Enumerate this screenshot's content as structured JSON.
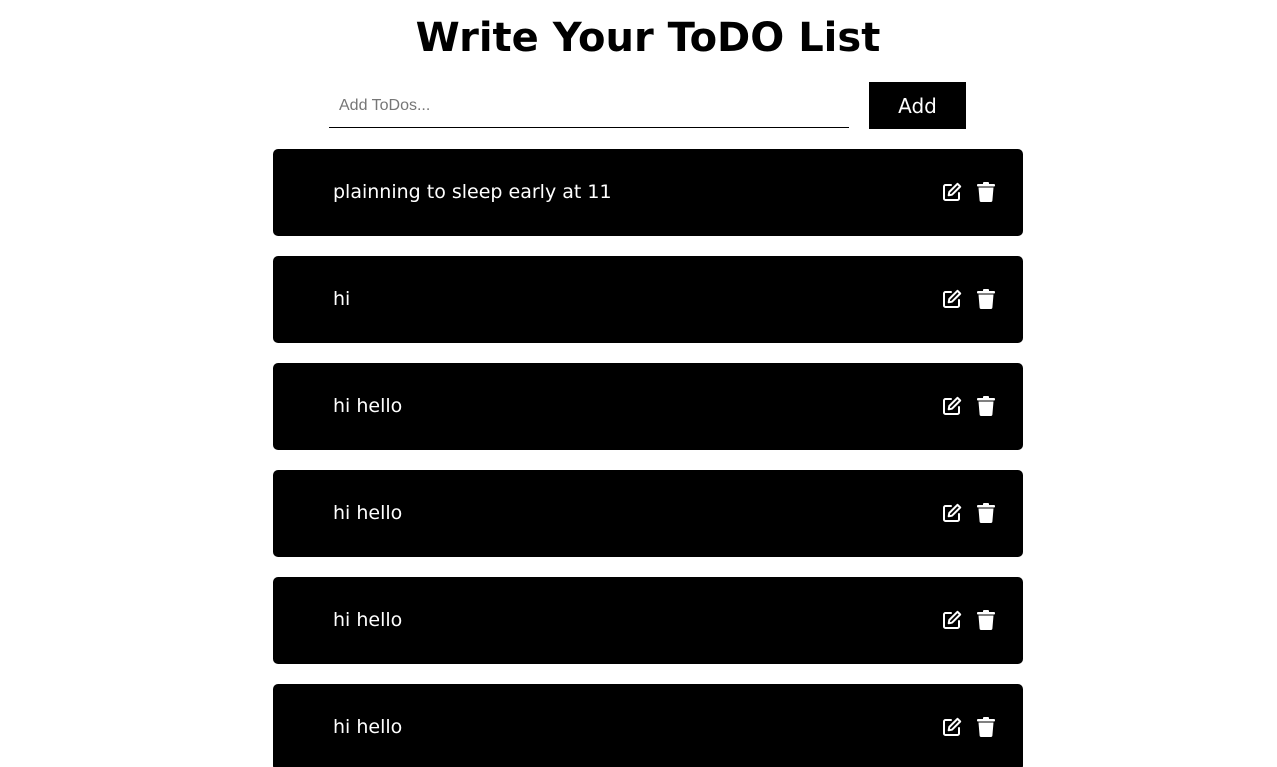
{
  "header": {
    "title": "Write Your ToDO List"
  },
  "form": {
    "input_value": "",
    "input_placeholder": "Add ToDos...",
    "add_label": "Add"
  },
  "todos": [
    {
      "text": "plainning to sleep early at 11",
      "edit_icon": "edit-icon",
      "delete_icon": "trash-icon"
    },
    {
      "text": "hi",
      "edit_icon": "edit-icon",
      "delete_icon": "trash-icon"
    },
    {
      "text": "hi hello",
      "edit_icon": "edit-icon",
      "delete_icon": "trash-icon"
    },
    {
      "text": "hi hello",
      "edit_icon": "edit-icon",
      "delete_icon": "trash-icon"
    },
    {
      "text": "hi hello",
      "edit_icon": "edit-icon",
      "delete_icon": "trash-icon"
    },
    {
      "text": "hi hello",
      "edit_icon": "edit-icon",
      "delete_icon": "trash-icon"
    }
  ],
  "colors": {
    "background": "#ffffff",
    "item_background": "#000000",
    "item_text": "#ffffff",
    "button_background": "#000000",
    "button_text": "#ffffff"
  }
}
